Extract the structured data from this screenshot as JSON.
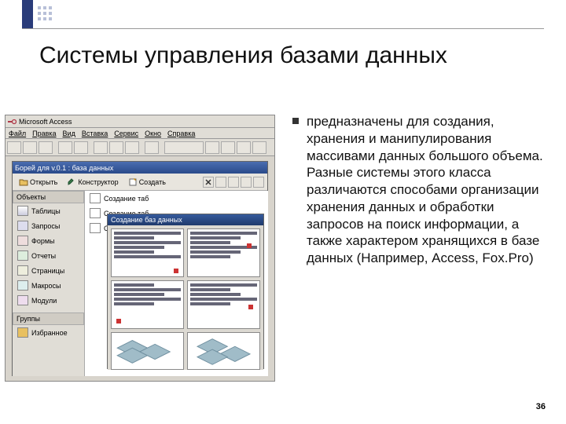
{
  "slide": {
    "title": "Системы управления базами данных",
    "page_number": "36",
    "bullet_text": "предназначены для создания, хранения и манипулирования массивами данных большого объема. Разные системы этого класса различаются способами организации хранения данных и обработки запросов на поиск информации, а также характером хранящихся в базе данных (Например, Access, Fox.Pro)"
  },
  "app": {
    "title": "Microsoft Access",
    "menu": [
      "Файл",
      "Правка",
      "Вид",
      "Вставка",
      "Сервис",
      "Окно",
      "Справка"
    ]
  },
  "db_window": {
    "title": "Борей для v.0.1 : база данных",
    "toolbar": {
      "open": "Открыть",
      "design": "Конструктор",
      "create": "Создать"
    },
    "side_header_objects": "Объекты",
    "side_items": [
      "Таблицы",
      "Запросы",
      "Формы",
      "Отчеты",
      "Страницы",
      "Макросы",
      "Модули"
    ],
    "side_header_groups": "Группы",
    "side_group_item": "Избранное",
    "links": [
      "Создание таб",
      "Создание таб",
      "Создание таб"
    ]
  },
  "wizard": {
    "title": "Создание баз данных"
  }
}
